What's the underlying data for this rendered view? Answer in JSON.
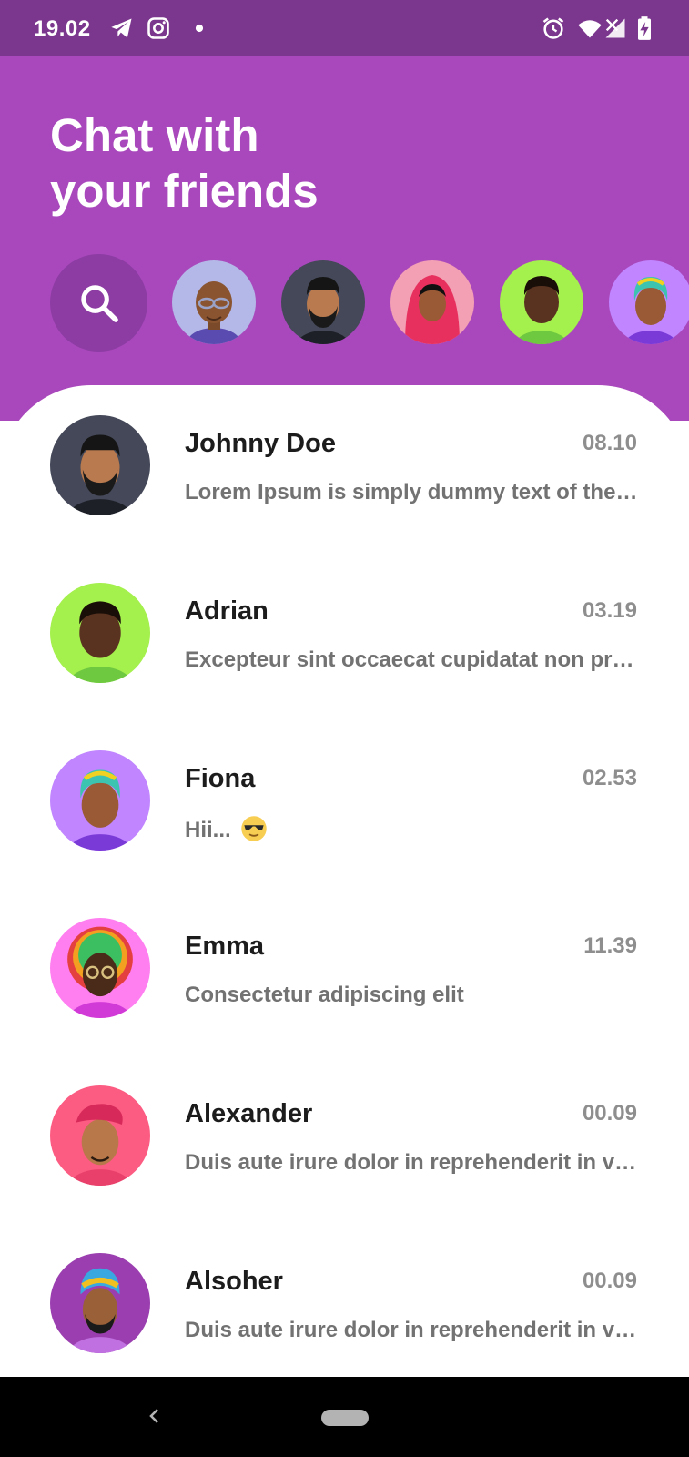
{
  "status_bar": {
    "time": "19.02",
    "left_icons": [
      "telegram-icon",
      "instagram-icon",
      "notification-dot-icon"
    ],
    "right_icons": [
      "alarm-icon",
      "wifi-icon",
      "signal-icon",
      "battery-charging-icon"
    ]
  },
  "header": {
    "title_line1": "Chat with",
    "title_line2": "your friends",
    "background": "#a948bc",
    "status_bar_color": "#7b368d",
    "search_icon": "search-icon"
  },
  "stories": [
    {
      "avatar": "avatar-bald-glasses",
      "bg": "#b4b8e8"
    },
    {
      "avatar": "avatar-bearded-man",
      "bg": "#444858"
    },
    {
      "avatar": "avatar-hijab-woman",
      "bg": "#f3a0b4"
    },
    {
      "avatar": "avatar-curly-man",
      "bg": "#a4f04c"
    },
    {
      "avatar": "avatar-rainbow-hair",
      "bg": "#c085ff"
    }
  ],
  "chats": [
    {
      "name": "Johnny Doe",
      "time": "08.10",
      "preview": "Lorem Ipsum is simply dummy text of the printing",
      "avatar_bg": "#444858"
    },
    {
      "name": "Adrian",
      "time": "03.19",
      "preview": "Excepteur sint occaecat cupidatat non proident",
      "avatar_bg": "#a4f04c"
    },
    {
      "name": "Fiona",
      "time": "02.53",
      "preview": "Hii...",
      "emoji": "sunglasses-emoji",
      "avatar_bg": "#c085ff"
    },
    {
      "name": "Emma",
      "time": "11.39",
      "preview": "Consectetur adipiscing elit",
      "avatar_bg": "#ff7ff0"
    },
    {
      "name": "Alexander",
      "time": "00.09",
      "preview": "Duis aute irure dolor in reprehenderit in voluptate",
      "avatar_bg": "#fc5b82"
    },
    {
      "name": "Alsoher",
      "time": "00.09",
      "preview": "Duis aute irure dolor in reprehenderit in voluptate",
      "avatar_bg": "#9b3fb0"
    }
  ],
  "nav_bar": {
    "back_icon": "back-chevron-icon",
    "home_icon": "home-pill-icon"
  }
}
